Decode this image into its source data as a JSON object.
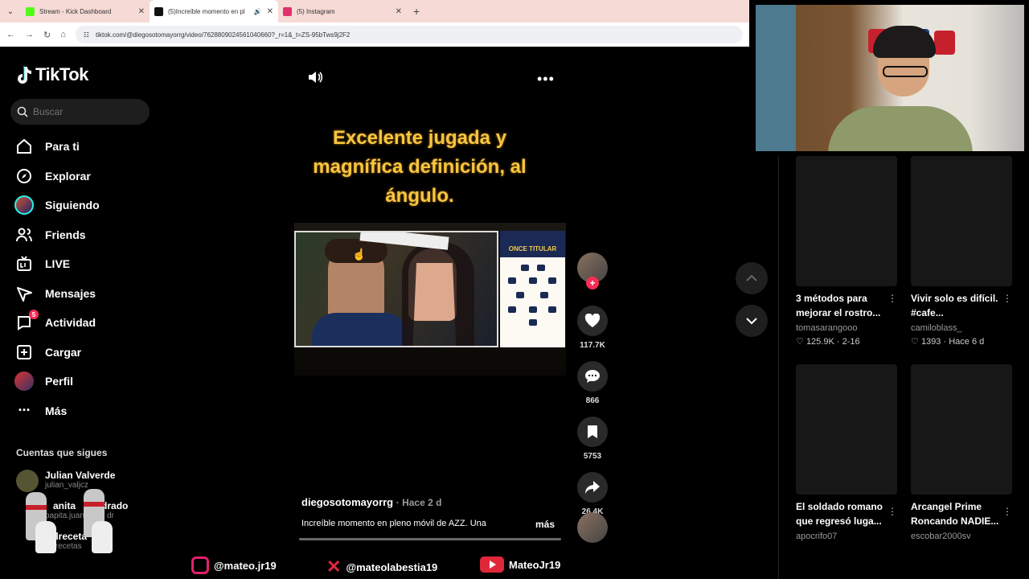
{
  "browser": {
    "tabs": [
      {
        "title": "Stream - Kick Dashboard",
        "fav_color": "#53fc18"
      },
      {
        "title": "(5)Increíble momento en pl",
        "fav_color": "#111111"
      },
      {
        "title": "(5) Instagram",
        "fav_color": "#e1306c"
      }
    ],
    "url": "tiktok.com/@diegosotomayorrg/video/7628809024561040660?_r=1&_t=ZS-95bTws9j2F2"
  },
  "sidebar": {
    "logo": "TikTok",
    "search_placeholder": "Buscar",
    "items": [
      {
        "label": "Para ti",
        "icon": "home-icon"
      },
      {
        "label": "Explorar",
        "icon": "compass-icon"
      },
      {
        "label": "Siguiendo",
        "icon": "following-avatar-icon"
      },
      {
        "label": "Friends",
        "icon": "friends-icon"
      },
      {
        "label": "LIVE",
        "icon": "live-icon"
      },
      {
        "label": "Mensajes",
        "icon": "message-icon"
      },
      {
        "label": "Actividad",
        "icon": "activity-icon",
        "badge": "5"
      },
      {
        "label": "Cargar",
        "icon": "upload-icon"
      },
      {
        "label": "Perfil",
        "icon": "profile-avatar-icon"
      },
      {
        "label": "Más",
        "icon": "more-icon"
      }
    ],
    "following_heading": "Cuentas que sigues",
    "following": [
      {
        "name": "Julian Valverde",
        "handle": "julian_valjcz"
      },
      {
        "name": "anita",
        "name_suffix": "drado",
        "handle": "papita.juan",
        "handle_suffix": "dr"
      },
      {
        "name": "Milreceta",
        "handle": "milrecetas"
      }
    ]
  },
  "video": {
    "caption": "Excelente jugada y magnífica definición, al ángulo.",
    "side_panel_title": "ONCE TITULAR",
    "author": "diegosotomayorrg",
    "ago": "· Hace 2 d",
    "description": "Increíble momento en pleno móvil de AZZ. Una",
    "more": "más",
    "progress": 1.0
  },
  "actions": {
    "likes": "117.7K",
    "comments": "866",
    "saves": "5753",
    "shares": "26.4K"
  },
  "related": [
    {
      "title": "3 métodos para mejorar el rostro...",
      "user": "tomasarangooo",
      "likes": "125.9K",
      "date": "2-16"
    },
    {
      "title": "Vivir solo es difícil. #cafe...",
      "user": "camiloblass_",
      "likes": "1393",
      "date": "Hace 6 d"
    },
    {
      "title": "El soldado romano que regresó luga...",
      "user": "apocrifo07"
    },
    {
      "title": "Arcangel Prime Roncando NADIE...",
      "user": "escobar2000sv"
    }
  ],
  "social": {
    "instagram": "@mateo.jr19",
    "x": "@mateolabestia19",
    "youtube": "MateoJr19"
  },
  "colors": {
    "accent": "#fe2c55",
    "caption": "#f6c542"
  }
}
